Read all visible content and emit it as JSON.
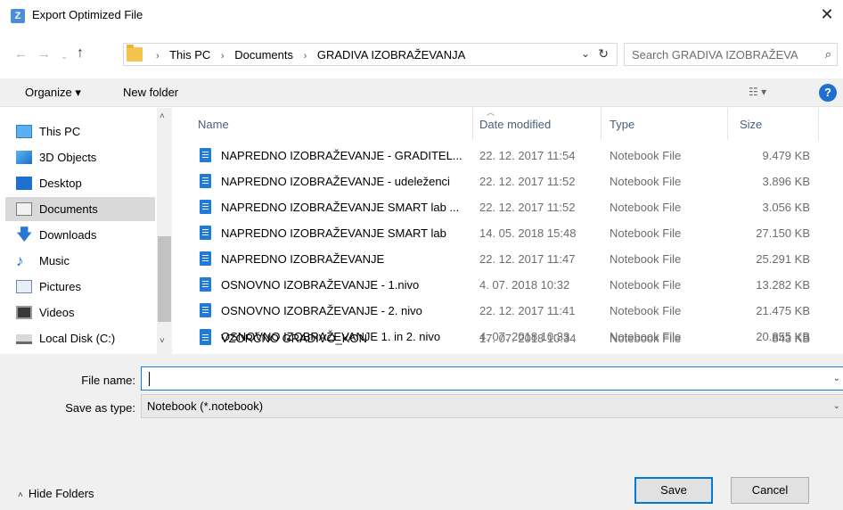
{
  "window": {
    "title": "Export Optimized File",
    "app_icon_glyph": "Z",
    "close_glyph": "✕"
  },
  "navigation": {
    "back_glyph": "←",
    "forward_glyph": "→",
    "recent_glyph": "⌄",
    "up_glyph": "↑"
  },
  "address": {
    "crumbs": [
      "This PC",
      "Documents",
      "GRADIVA IZOBRAŽEVANJA"
    ],
    "separator": "›",
    "dropdown_glyph": "⌄",
    "refresh_glyph": "↻"
  },
  "search": {
    "placeholder": "Search GRADIVA IZOBRAŽEVA",
    "icon_glyph": "⌕"
  },
  "toolbar": {
    "organize_label": "Organize ▾",
    "new_folder_label": "New folder",
    "view_glyph": "☷ ▾",
    "help_glyph": "?"
  },
  "sidebar": {
    "items": [
      {
        "label": "This PC",
        "icon": "pc-icon"
      },
      {
        "label": "3D Objects",
        "icon": "cube-icon"
      },
      {
        "label": "Desktop",
        "icon": "desktop-icon"
      },
      {
        "label": "Documents",
        "icon": "documents-icon",
        "selected": true
      },
      {
        "label": "Downloads",
        "icon": "download-icon"
      },
      {
        "label": "Music",
        "icon": "music-icon"
      },
      {
        "label": "Pictures",
        "icon": "pictures-icon"
      },
      {
        "label": "Videos",
        "icon": "videos-icon"
      },
      {
        "label": "Local Disk (C:)",
        "icon": "disk-icon"
      }
    ],
    "scroll_up_glyph": "˄",
    "scroll_down_glyph": "˅"
  },
  "columns": {
    "name": "Name",
    "date": "Date modified",
    "type": "Type",
    "size": "Size"
  },
  "files": [
    {
      "name": "NAPREDNO IZOBRAŽEVANJE - GRADITEL...",
      "date": "22. 12. 2017 11:54",
      "type": "Notebook File",
      "size": "9.479 KB"
    },
    {
      "name": "NAPREDNO IZOBRAŽEVANJE - udeleženci",
      "date": "22. 12. 2017 11:52",
      "type": "Notebook File",
      "size": "3.896 KB"
    },
    {
      "name": "NAPREDNO IZOBRAŽEVANJE SMART lab ...",
      "date": "22. 12. 2017 11:52",
      "type": "Notebook File",
      "size": "3.056 KB"
    },
    {
      "name": "NAPREDNO IZOBRAŽEVANJE SMART lab",
      "date": "14. 05. 2018 15:48",
      "type": "Notebook File",
      "size": "27.150 KB"
    },
    {
      "name": "NAPREDNO IZOBRAŽEVANJE",
      "date": "22. 12. 2017 11:47",
      "type": "Notebook File",
      "size": "25.291 KB"
    },
    {
      "name": "OSNOVNO IZOBRAŽEVANJE - 1.nivo",
      "date": "4. 07. 2018 10:32",
      "type": "Notebook File",
      "size": "13.282 KB"
    },
    {
      "name": "OSNOVNO IZOBRAŽEVANJE - 2. nivo",
      "date": "22. 12. 2017 11:41",
      "type": "Notebook File",
      "size": "21.475 KB"
    },
    {
      "name": "OSNOVNO IZOBRAŽEVANJE 1. in 2. nivo",
      "date": "4. 07. 2018 10:33",
      "type": "Notebook File",
      "size": "20.855 KB"
    },
    {
      "name": "VZORČNO GRADIVO_KON",
      "date": "17. 07. 2018 10:34",
      "type": "Notebook File",
      "size": "843 KB"
    }
  ],
  "form": {
    "file_name_label": "File name:",
    "file_name_value": "",
    "save_type_label": "Save as type:",
    "save_type_value": "Notebook (*.notebook)",
    "dropdown_glyph": "⌄"
  },
  "footer": {
    "hide_folders_label": "Hide Folders",
    "hide_folders_glyph": "˄",
    "save_label": "Save",
    "cancel_label": "Cancel"
  },
  "colors": {
    "accent": "#0078d7",
    "selected_nav": "#d9d9d9",
    "toolbar_bg": "#f0f0f0",
    "header_text": "#4c607a"
  }
}
